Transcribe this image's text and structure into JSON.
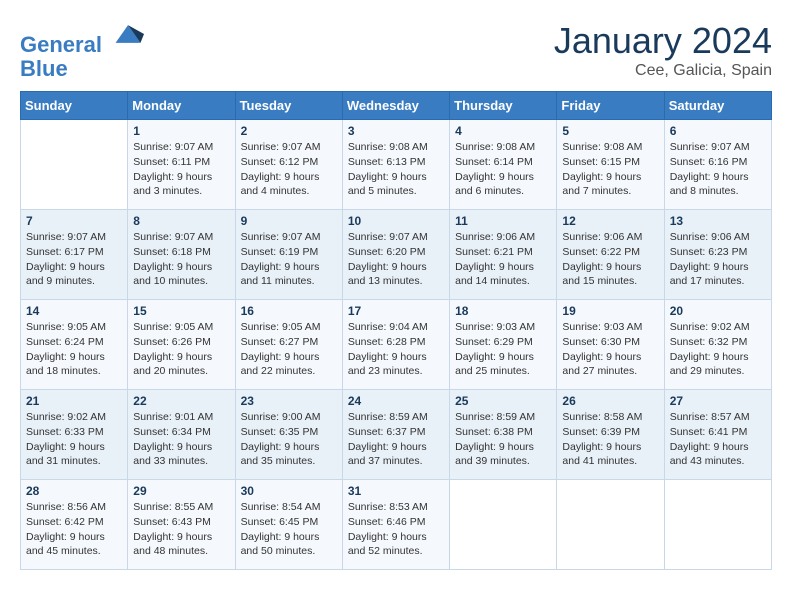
{
  "header": {
    "logo_line1": "General",
    "logo_line2": "Blue",
    "month": "January 2024",
    "location": "Cee, Galicia, Spain"
  },
  "columns": [
    "Sunday",
    "Monday",
    "Tuesday",
    "Wednesday",
    "Thursday",
    "Friday",
    "Saturday"
  ],
  "weeks": [
    [
      {
        "num": "",
        "info": ""
      },
      {
        "num": "1",
        "info": "Sunrise: 9:07 AM\nSunset: 6:11 PM\nDaylight: 9 hours\nand 3 minutes."
      },
      {
        "num": "2",
        "info": "Sunrise: 9:07 AM\nSunset: 6:12 PM\nDaylight: 9 hours\nand 4 minutes."
      },
      {
        "num": "3",
        "info": "Sunrise: 9:08 AM\nSunset: 6:13 PM\nDaylight: 9 hours\nand 5 minutes."
      },
      {
        "num": "4",
        "info": "Sunrise: 9:08 AM\nSunset: 6:14 PM\nDaylight: 9 hours\nand 6 minutes."
      },
      {
        "num": "5",
        "info": "Sunrise: 9:08 AM\nSunset: 6:15 PM\nDaylight: 9 hours\nand 7 minutes."
      },
      {
        "num": "6",
        "info": "Sunrise: 9:07 AM\nSunset: 6:16 PM\nDaylight: 9 hours\nand 8 minutes."
      }
    ],
    [
      {
        "num": "7",
        "info": "Sunrise: 9:07 AM\nSunset: 6:17 PM\nDaylight: 9 hours\nand 9 minutes."
      },
      {
        "num": "8",
        "info": "Sunrise: 9:07 AM\nSunset: 6:18 PM\nDaylight: 9 hours\nand 10 minutes."
      },
      {
        "num": "9",
        "info": "Sunrise: 9:07 AM\nSunset: 6:19 PM\nDaylight: 9 hours\nand 11 minutes."
      },
      {
        "num": "10",
        "info": "Sunrise: 9:07 AM\nSunset: 6:20 PM\nDaylight: 9 hours\nand 13 minutes."
      },
      {
        "num": "11",
        "info": "Sunrise: 9:06 AM\nSunset: 6:21 PM\nDaylight: 9 hours\nand 14 minutes."
      },
      {
        "num": "12",
        "info": "Sunrise: 9:06 AM\nSunset: 6:22 PM\nDaylight: 9 hours\nand 15 minutes."
      },
      {
        "num": "13",
        "info": "Sunrise: 9:06 AM\nSunset: 6:23 PM\nDaylight: 9 hours\nand 17 minutes."
      }
    ],
    [
      {
        "num": "14",
        "info": "Sunrise: 9:05 AM\nSunset: 6:24 PM\nDaylight: 9 hours\nand 18 minutes."
      },
      {
        "num": "15",
        "info": "Sunrise: 9:05 AM\nSunset: 6:26 PM\nDaylight: 9 hours\nand 20 minutes."
      },
      {
        "num": "16",
        "info": "Sunrise: 9:05 AM\nSunset: 6:27 PM\nDaylight: 9 hours\nand 22 minutes."
      },
      {
        "num": "17",
        "info": "Sunrise: 9:04 AM\nSunset: 6:28 PM\nDaylight: 9 hours\nand 23 minutes."
      },
      {
        "num": "18",
        "info": "Sunrise: 9:03 AM\nSunset: 6:29 PM\nDaylight: 9 hours\nand 25 minutes."
      },
      {
        "num": "19",
        "info": "Sunrise: 9:03 AM\nSunset: 6:30 PM\nDaylight: 9 hours\nand 27 minutes."
      },
      {
        "num": "20",
        "info": "Sunrise: 9:02 AM\nSunset: 6:32 PM\nDaylight: 9 hours\nand 29 minutes."
      }
    ],
    [
      {
        "num": "21",
        "info": "Sunrise: 9:02 AM\nSunset: 6:33 PM\nDaylight: 9 hours\nand 31 minutes."
      },
      {
        "num": "22",
        "info": "Sunrise: 9:01 AM\nSunset: 6:34 PM\nDaylight: 9 hours\nand 33 minutes."
      },
      {
        "num": "23",
        "info": "Sunrise: 9:00 AM\nSunset: 6:35 PM\nDaylight: 9 hours\nand 35 minutes."
      },
      {
        "num": "24",
        "info": "Sunrise: 8:59 AM\nSunset: 6:37 PM\nDaylight: 9 hours\nand 37 minutes."
      },
      {
        "num": "25",
        "info": "Sunrise: 8:59 AM\nSunset: 6:38 PM\nDaylight: 9 hours\nand 39 minutes."
      },
      {
        "num": "26",
        "info": "Sunrise: 8:58 AM\nSunset: 6:39 PM\nDaylight: 9 hours\nand 41 minutes."
      },
      {
        "num": "27",
        "info": "Sunrise: 8:57 AM\nSunset: 6:41 PM\nDaylight: 9 hours\nand 43 minutes."
      }
    ],
    [
      {
        "num": "28",
        "info": "Sunrise: 8:56 AM\nSunset: 6:42 PM\nDaylight: 9 hours\nand 45 minutes."
      },
      {
        "num": "29",
        "info": "Sunrise: 8:55 AM\nSunset: 6:43 PM\nDaylight: 9 hours\nand 48 minutes."
      },
      {
        "num": "30",
        "info": "Sunrise: 8:54 AM\nSunset: 6:45 PM\nDaylight: 9 hours\nand 50 minutes."
      },
      {
        "num": "31",
        "info": "Sunrise: 8:53 AM\nSunset: 6:46 PM\nDaylight: 9 hours\nand 52 minutes."
      },
      {
        "num": "",
        "info": ""
      },
      {
        "num": "",
        "info": ""
      },
      {
        "num": "",
        "info": ""
      }
    ]
  ]
}
